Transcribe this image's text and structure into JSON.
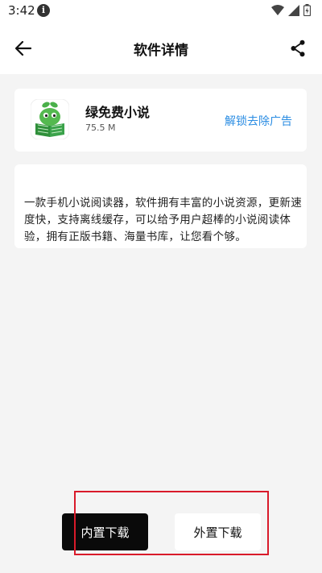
{
  "status_bar": {
    "time": "3:42",
    "icons": [
      "info-icon",
      "wifi-icon",
      "signal-icon",
      "battery-icon"
    ]
  },
  "app_bar": {
    "title": "软件详情",
    "back_icon": "arrow-left-icon",
    "share_icon": "share-icon"
  },
  "app_card": {
    "name": "绿免费小说",
    "size": "75.5 M",
    "unlock_label": "解锁去除广告",
    "icon": "green-sprout-reading-book-icon"
  },
  "description": {
    "text": "一款手机小说阅读器，软件拥有丰富的小说资源，更新速度快，支持离线缓存，可以给予用户超棒的小说阅读体验，拥有正版书籍、海量书库，让您看个够。"
  },
  "actions": {
    "internal_download": "内置下载",
    "external_download": "外置下载"
  },
  "colors": {
    "accent_link": "#2b8de3",
    "primary_button": "#0a0a0a",
    "highlight_border": "#d91a2a",
    "background": "#f4f4f4"
  }
}
